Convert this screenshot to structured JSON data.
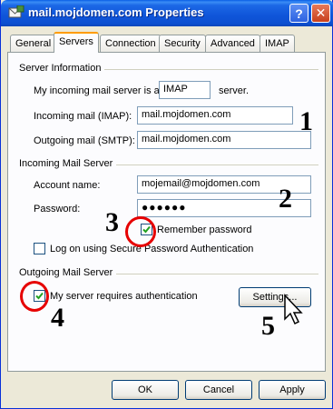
{
  "window": {
    "title": "mail.mojdomen.com Properties",
    "help_glyph": "?",
    "close_glyph": "✕"
  },
  "tabs": [
    {
      "label": "General"
    },
    {
      "label": "Servers"
    },
    {
      "label": "Connection"
    },
    {
      "label": "Security"
    },
    {
      "label": "Advanced"
    },
    {
      "label": "IMAP"
    }
  ],
  "server_info": {
    "heading": "Server Information",
    "incoming_type_prefix": "My incoming mail server is a",
    "incoming_type_value": "IMAP",
    "incoming_type_suffix": "server.",
    "incoming_label": "Incoming mail (IMAP):",
    "incoming_value": "mail.mojdomen.com",
    "outgoing_label": "Outgoing mail (SMTP):",
    "outgoing_value": "mail.mojdomen.com"
  },
  "incoming_server": {
    "heading": "Incoming Mail Server",
    "account_label": "Account name:",
    "account_value": "mojemail@mojdomen.com",
    "password_label": "Password:",
    "password_value": "●●●●●●",
    "remember_label": "Remember password",
    "remember_checked": true,
    "spa_label": "Log on using Secure Password Authentication",
    "spa_checked": false
  },
  "outgoing_server": {
    "heading": "Outgoing Mail Server",
    "auth_label": "My server requires authentication",
    "auth_checked": true,
    "settings_button": "Settings..."
  },
  "buttons": {
    "ok": "OK",
    "cancel": "Cancel",
    "apply": "Apply"
  },
  "annotations": {
    "n1": "1",
    "n2": "2",
    "n3": "3",
    "n4": "4",
    "n5": "5",
    "color": "#e60000"
  }
}
